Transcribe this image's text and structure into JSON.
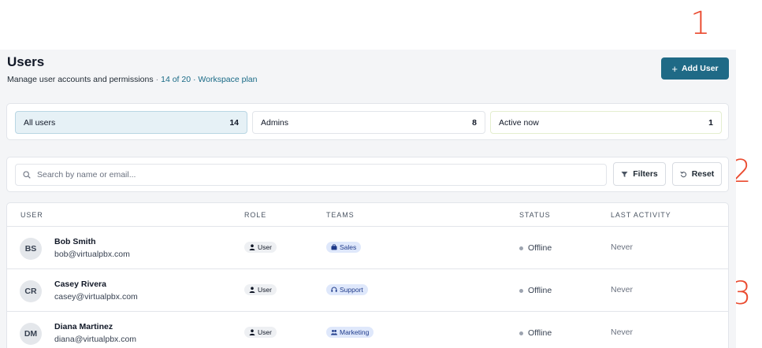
{
  "annotations": [
    "1",
    "2",
    "3"
  ],
  "header": {
    "title": "Users",
    "subtitle": "Manage user accounts and permissions",
    "separator": "·",
    "plan_info": "14 of 20 · Workspace plan",
    "add_user_label": "Add User",
    "add_icon": "plus-icon"
  },
  "segments": [
    {
      "label": "All users",
      "count": "14"
    },
    {
      "label": "Admins",
      "count": "8"
    },
    {
      "label": "Active now",
      "count": "1"
    }
  ],
  "toolbar": {
    "search_placeholder": "Search by name or email...",
    "filters_label": "Filters",
    "reset_label": "Reset"
  },
  "table": {
    "columns": [
      "USER",
      "ROLE",
      "TEAMS",
      "STATUS",
      "LAST ACTIVITY"
    ],
    "rows": [
      {
        "initials": "BS",
        "name": "Bob Smith",
        "email": "bob@virtualpbx.com",
        "role": "User",
        "team": "Sales",
        "team_icon": "briefcase-icon",
        "status": "Offline",
        "last_activity": "Never"
      },
      {
        "initials": "CR",
        "name": "Casey Rivera",
        "email": "casey@virtualpbx.com",
        "role": "User",
        "team": "Support",
        "team_icon": "headset-icon",
        "status": "Offline",
        "last_activity": "Never"
      },
      {
        "initials": "DM",
        "name": "Diana Martinez",
        "email": "diana@virtualpbx.com",
        "role": "User",
        "team": "Marketing",
        "team_icon": "people-icon",
        "status": "Offline",
        "last_activity": "Never"
      }
    ]
  },
  "colors": {
    "primary": "#1f6a86",
    "link": "#196a86",
    "annotation": "#ea4a2f",
    "active_segment_bg": "#e6f1f6",
    "team_pill_bg": "#dfe8fb"
  }
}
